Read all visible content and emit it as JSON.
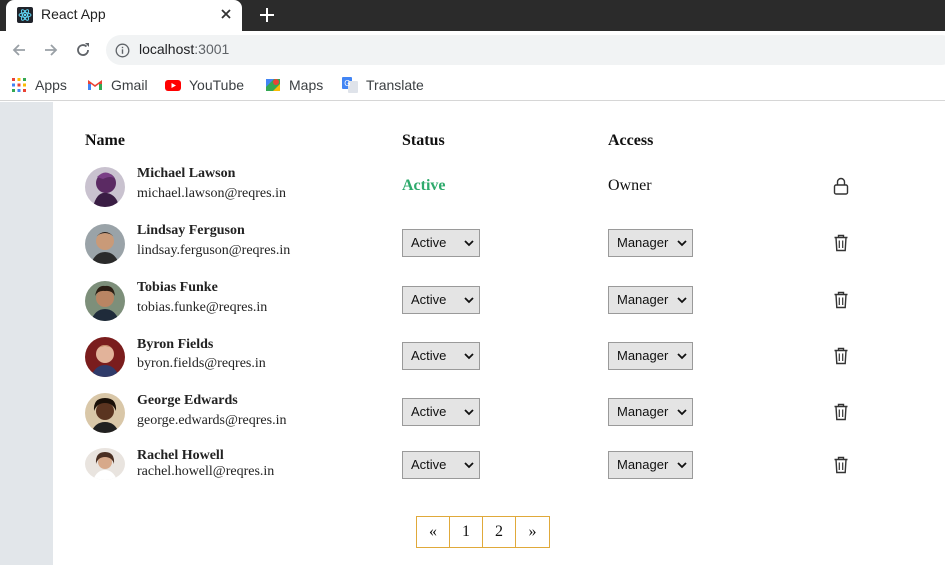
{
  "browser": {
    "tab_title": "React App",
    "url_host": "localhost",
    "url_port": ":3001",
    "bookmarks": [
      {
        "label": "Apps",
        "icon": "apps-grid-icon"
      },
      {
        "label": "Gmail",
        "icon": "gmail-icon"
      },
      {
        "label": "YouTube",
        "icon": "youtube-icon"
      },
      {
        "label": "Maps",
        "icon": "maps-icon"
      },
      {
        "label": "Translate",
        "icon": "translate-icon"
      }
    ]
  },
  "table": {
    "headers": {
      "name": "Name",
      "status": "Status",
      "access": "Access"
    },
    "rows": [
      {
        "name": "Michael Lawson",
        "email": "michael.lawson@reqres.in",
        "status": "Active",
        "access": "Owner",
        "action_icon": "lock-icon"
      },
      {
        "name": "Lindsay Ferguson",
        "email": "lindsay.ferguson@reqres.in",
        "status": "Active",
        "access": "Manager",
        "action_icon": "trash-icon"
      },
      {
        "name": "Tobias Funke",
        "email": "tobias.funke@reqres.in",
        "status": "Active",
        "access": "Manager",
        "action_icon": "trash-icon"
      },
      {
        "name": "Byron Fields",
        "email": "byron.fields@reqres.in",
        "status": "Active",
        "access": "Manager",
        "action_icon": "trash-icon"
      },
      {
        "name": "George Edwards",
        "email": "george.edwards@reqres.in",
        "status": "Active",
        "access": "Manager",
        "action_icon": "trash-icon"
      },
      {
        "name": "Rachel Howell",
        "email": "rachel.howell@reqres.in",
        "status": "Active",
        "access": "Manager",
        "action_icon": "trash-icon"
      }
    ]
  },
  "pagination": {
    "prev": "«",
    "pages": [
      "1",
      "2"
    ],
    "next": "»"
  },
  "colors": {
    "active_status": "#2eaa6c",
    "pager_border": "#e0a93a",
    "sidebar": "#e2e6ea"
  }
}
